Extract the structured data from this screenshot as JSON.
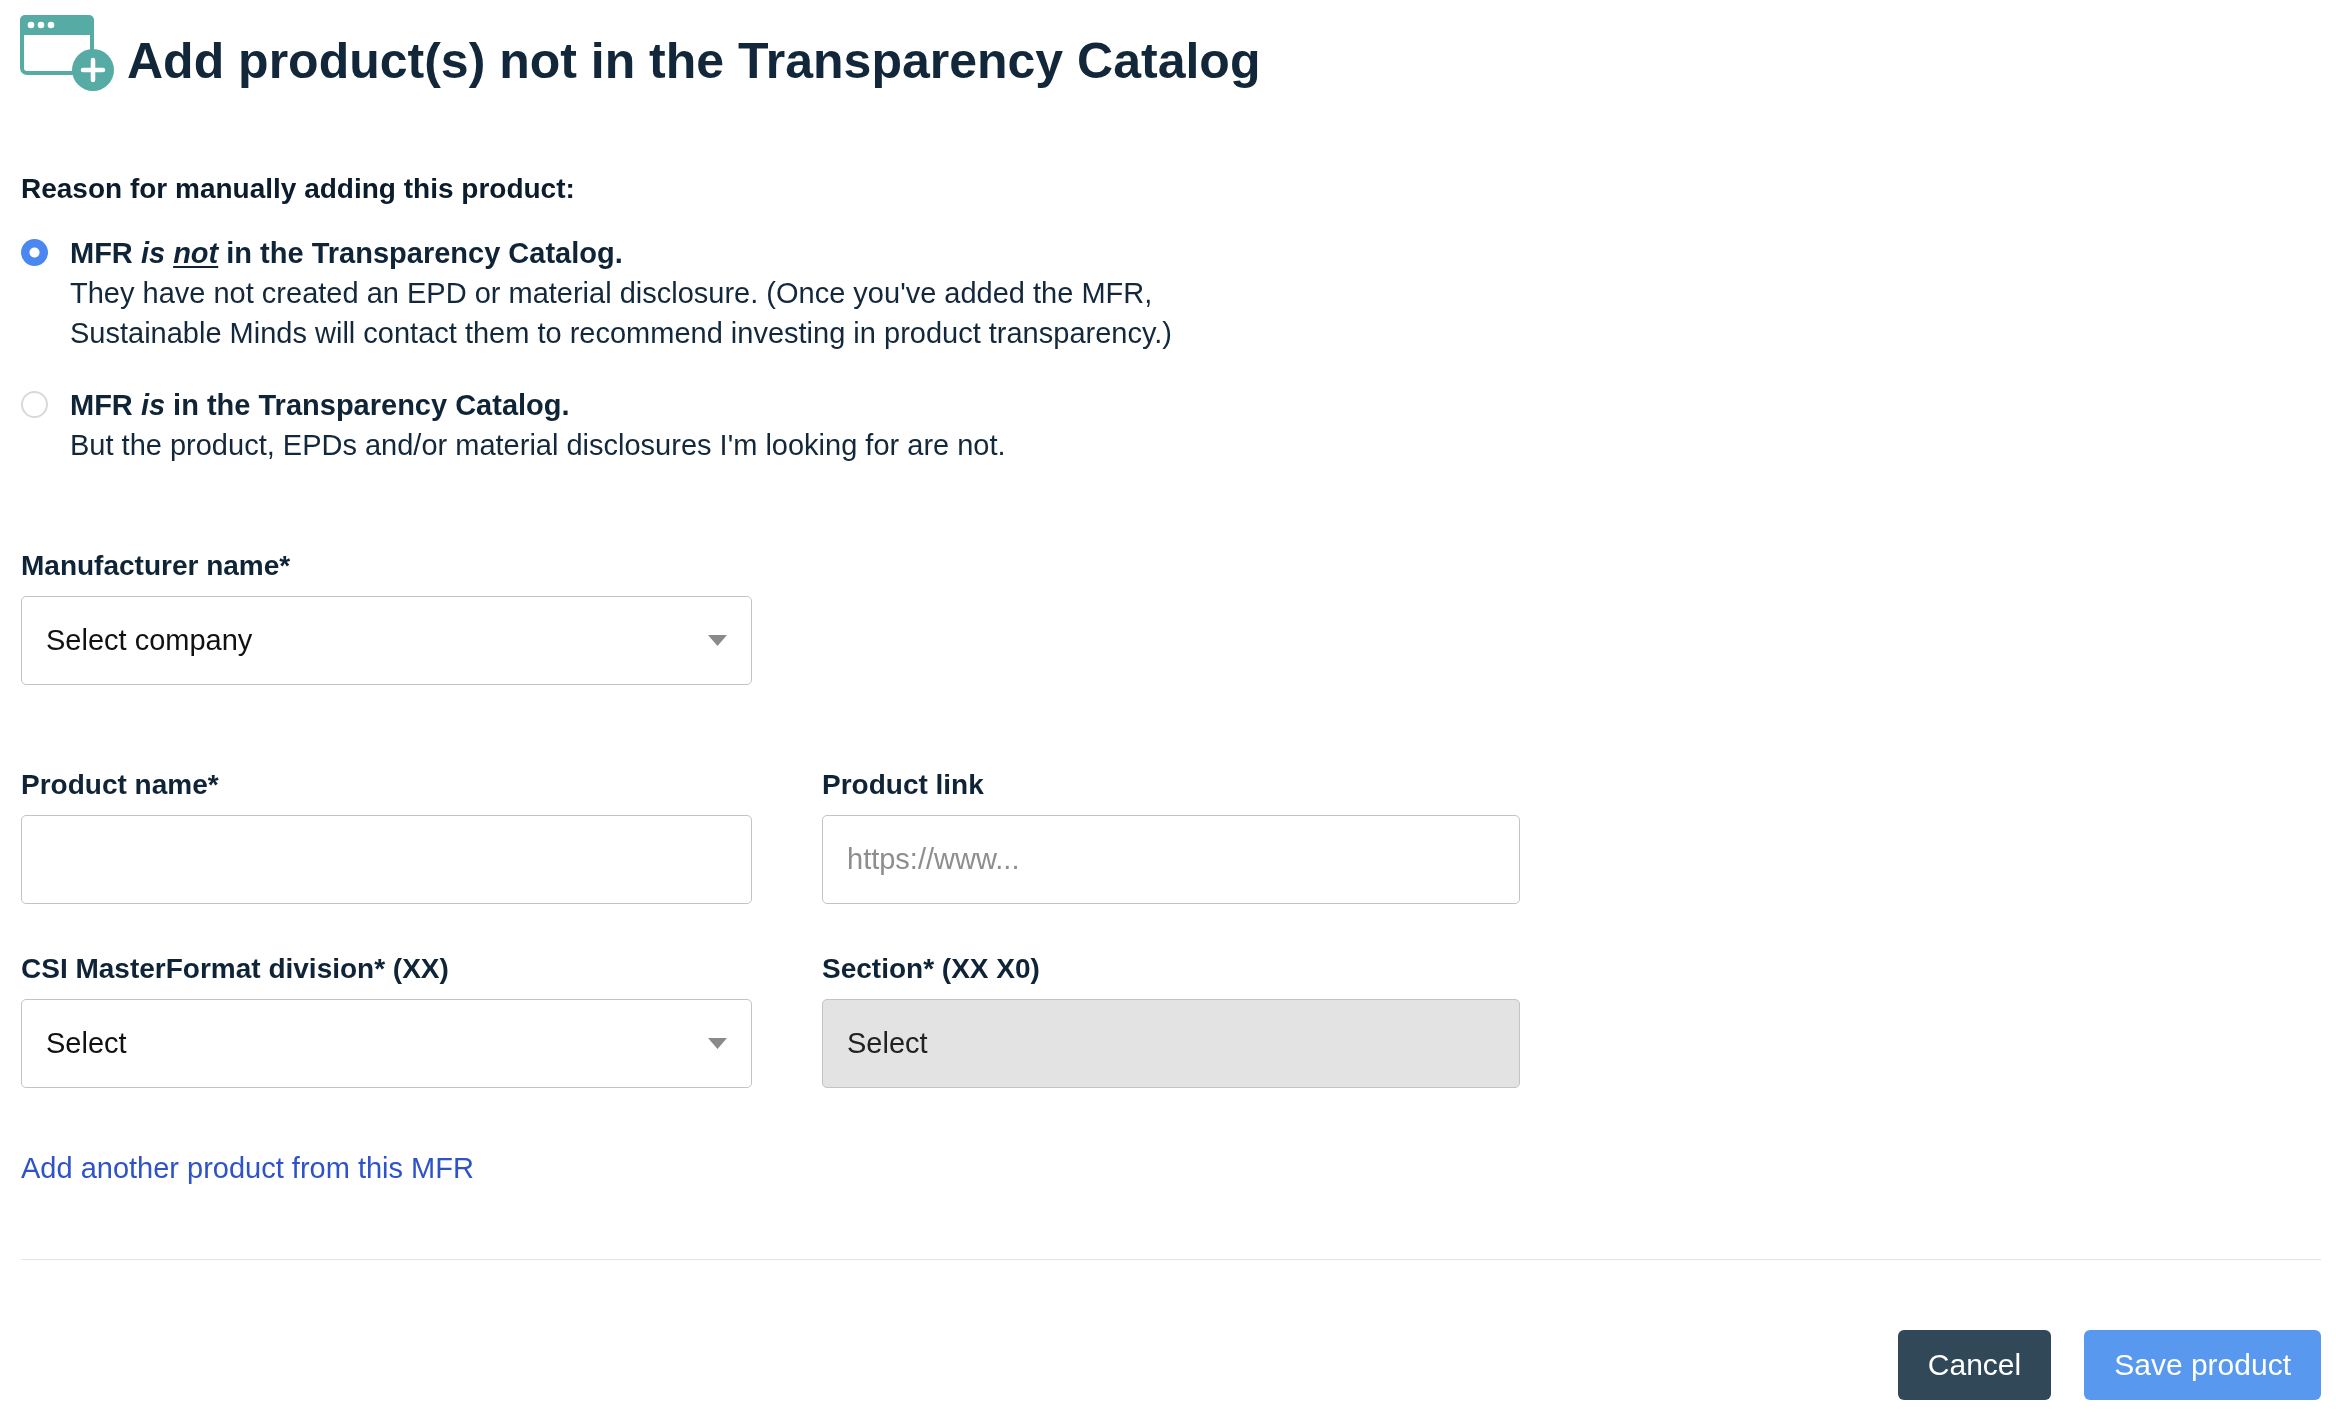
{
  "header": {
    "title": "Add product(s) not in the Transparency Catalog"
  },
  "reason": {
    "label": "Reason for manually adding this product:",
    "options": [
      {
        "selected": true,
        "title": [
          {
            "text": "MFR ",
            "italic": false,
            "underline": false
          },
          {
            "text": "is ",
            "italic": true,
            "underline": false
          },
          {
            "text": "not",
            "italic": true,
            "underline": true
          },
          {
            "text": " in the Transparency Catalog.",
            "italic": false,
            "underline": false
          }
        ],
        "description": "They have not created an EPD or material disclosure. (Once you've added the MFR, Sustainable Minds will contact them to recommend investing in product transparency.)"
      },
      {
        "selected": false,
        "title": [
          {
            "text": "MFR ",
            "italic": false,
            "underline": false
          },
          {
            "text": "is",
            "italic": true,
            "underline": false
          },
          {
            "text": " in the Transparency Catalog.",
            "italic": false,
            "underline": false
          }
        ],
        "description": "But the product, EPDs and/or material disclosures I'm looking for are not."
      }
    ]
  },
  "manufacturer": {
    "kind": "select",
    "label": "Manufacturer name*",
    "value": "Select company",
    "disabled": false
  },
  "product": {
    "fields": [
      {
        "kind": "text",
        "label": "Product name*",
        "disabled": false
      },
      {
        "kind": "text",
        "label": "Product link",
        "placeholder": "https://www...",
        "disabled": false
      },
      {
        "kind": "select",
        "label": "CSI MasterFormat division* (XX)",
        "value": "Select",
        "disabled": false
      },
      {
        "kind": "select",
        "label": "Section* (XX X0)",
        "value": "Select",
        "disabled": true
      }
    ]
  },
  "add_link": {
    "label": "Add another product from this MFR"
  },
  "buttons": [
    {
      "kind": "secondary",
      "label": "Cancel"
    },
    {
      "kind": "primary",
      "label": "Save product"
    }
  ]
}
